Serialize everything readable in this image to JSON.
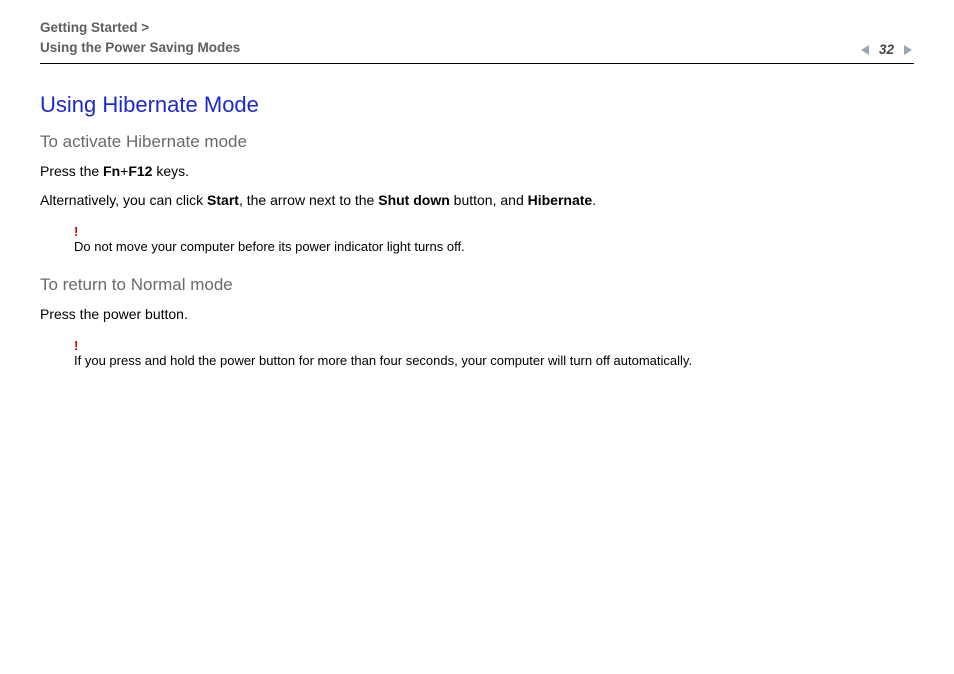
{
  "header": {
    "breadcrumb_line1": "Getting Started >",
    "breadcrumb_line2": "Using the Power Saving Modes",
    "page_number": "32"
  },
  "main": {
    "title": "Using Hibernate Mode",
    "section1": {
      "heading": "To activate Hibernate mode",
      "line1_pre": "Press the ",
      "line1_key1": "Fn",
      "line1_plus": "+",
      "line1_key2": "F12",
      "line1_post": " keys.",
      "line2_pre": "Alternatively, you can click ",
      "line2_b1": "Start",
      "line2_mid1": ", the arrow next to the ",
      "line2_b2": "Shut down",
      "line2_mid2": " button, and ",
      "line2_b3": "Hibernate",
      "line2_post": ".",
      "note_bang": "!",
      "note_text": "Do not move your computer before its power indicator light turns off."
    },
    "section2": {
      "heading": "To return to Normal mode",
      "line1": "Press the power button.",
      "note_bang": "!",
      "note_text": "If you press and hold the power button for more than four seconds, your computer will turn off automatically."
    }
  }
}
